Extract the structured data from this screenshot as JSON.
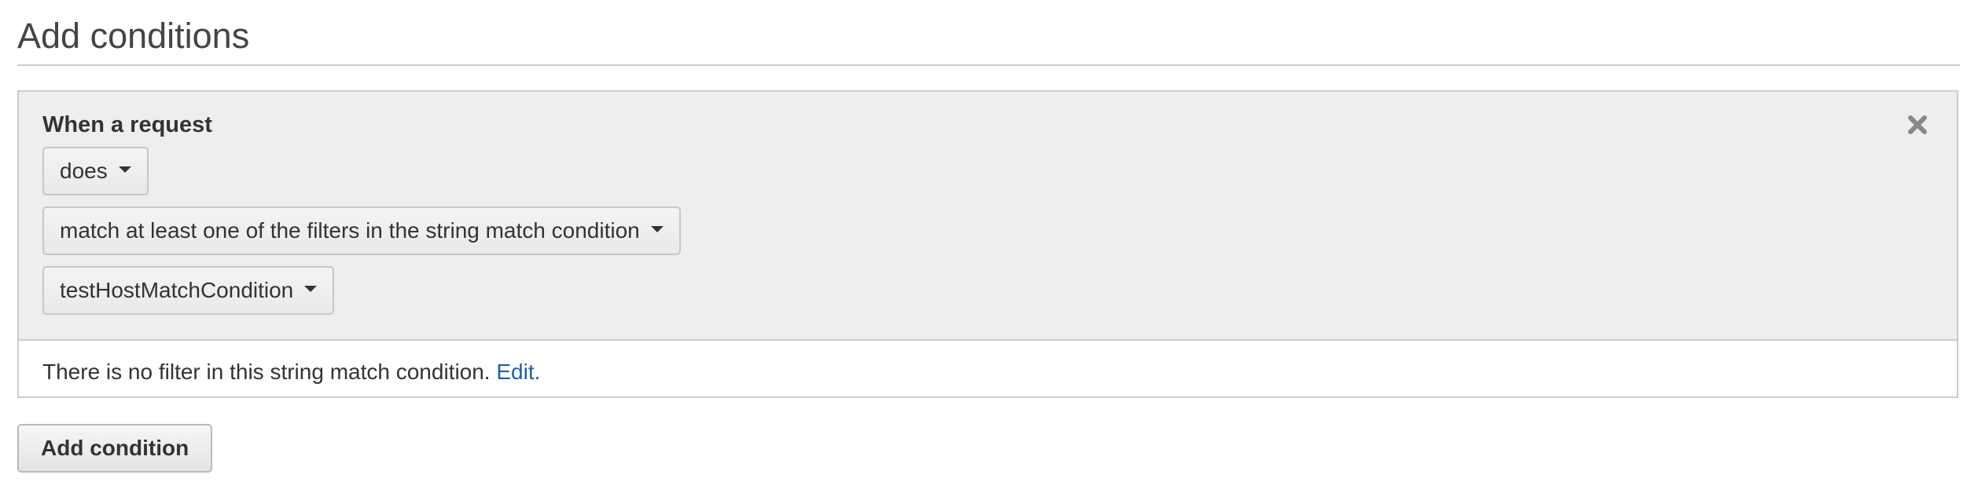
{
  "section": {
    "title": "Add conditions"
  },
  "condition": {
    "label": "When a request",
    "remove_icon": "close-icon",
    "dropdowns": [
      "does",
      "match at least one of the filters in the string match condition",
      "testHostMatchCondition"
    ],
    "note_text": "There is no filter in this string match condition.",
    "note_link": "Edit."
  },
  "actions": {
    "add_condition_label": "Add condition"
  },
  "colors": {
    "panel_bg": "#eeeeee",
    "border": "#cccccc",
    "link": "#1f5fa8",
    "text": "#333333"
  }
}
